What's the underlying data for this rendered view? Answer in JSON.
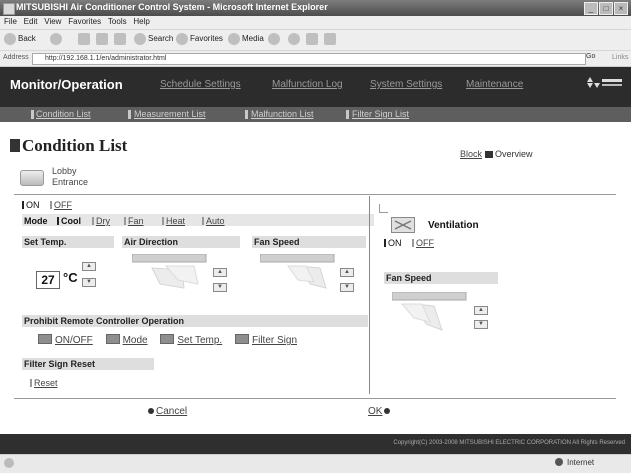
{
  "window": {
    "title": "MITSUBISHI Air Conditioner Control System - Microsoft Internet Explorer"
  },
  "menubar": {
    "items": [
      "File",
      "Edit",
      "View",
      "Favorites",
      "Tools",
      "Help"
    ]
  },
  "toolbar": {
    "back": "Back",
    "search": "Search",
    "favorites": "Favorites",
    "media": "Media"
  },
  "addressbar": {
    "label": "Address",
    "url": "http://192.168.1.1/en/administrator.html",
    "go": "Go",
    "links": "Links"
  },
  "app": {
    "title": "Monitor/Operation",
    "nav": [
      "Schedule Settings",
      "Malfunction Log",
      "System Settings",
      "Maintenance"
    ],
    "brand": "MITSUBISHI ELECTRIC",
    "subnav": [
      "Condition List",
      "Measurement List",
      "Malfunction List",
      "Filter Sign List"
    ]
  },
  "page": {
    "heading": "Condition List",
    "view_block": "Block",
    "view_overview": "Overview",
    "unit_name_1": "Lobby",
    "unit_name_2": "Entrance"
  },
  "power": {
    "on": "ON",
    "off": "OFF"
  },
  "mode": {
    "label": "Mode",
    "options": [
      "Cool",
      "Dry",
      "Fan",
      "Heat",
      "Auto"
    ],
    "selected": "Cool"
  },
  "set_temp": {
    "label": "Set Temp.",
    "value": "27",
    "unit": "°C"
  },
  "air_direction": {
    "label": "Air Direction"
  },
  "fan_speed": {
    "label": "Fan Speed"
  },
  "prohibit": {
    "label": "Prohibit Remote Controller Operation",
    "items": [
      "ON/OFF",
      "Mode",
      "Set Temp.",
      "Filter Sign"
    ]
  },
  "filter_reset": {
    "label": "Filter Sign Reset",
    "reset": "Reset"
  },
  "ventilation": {
    "title": "Ventilation",
    "on": "ON",
    "off": "OFF",
    "fan_label": "Fan Speed"
  },
  "actions": {
    "cancel": "Cancel",
    "ok": "OK"
  },
  "footer": {
    "copyright": "Copyright(C) 2003-2008 MITSUBISHI ELECTRIC CORPORATION All Rights Reserved"
  },
  "status": {
    "zone": "Internet"
  }
}
